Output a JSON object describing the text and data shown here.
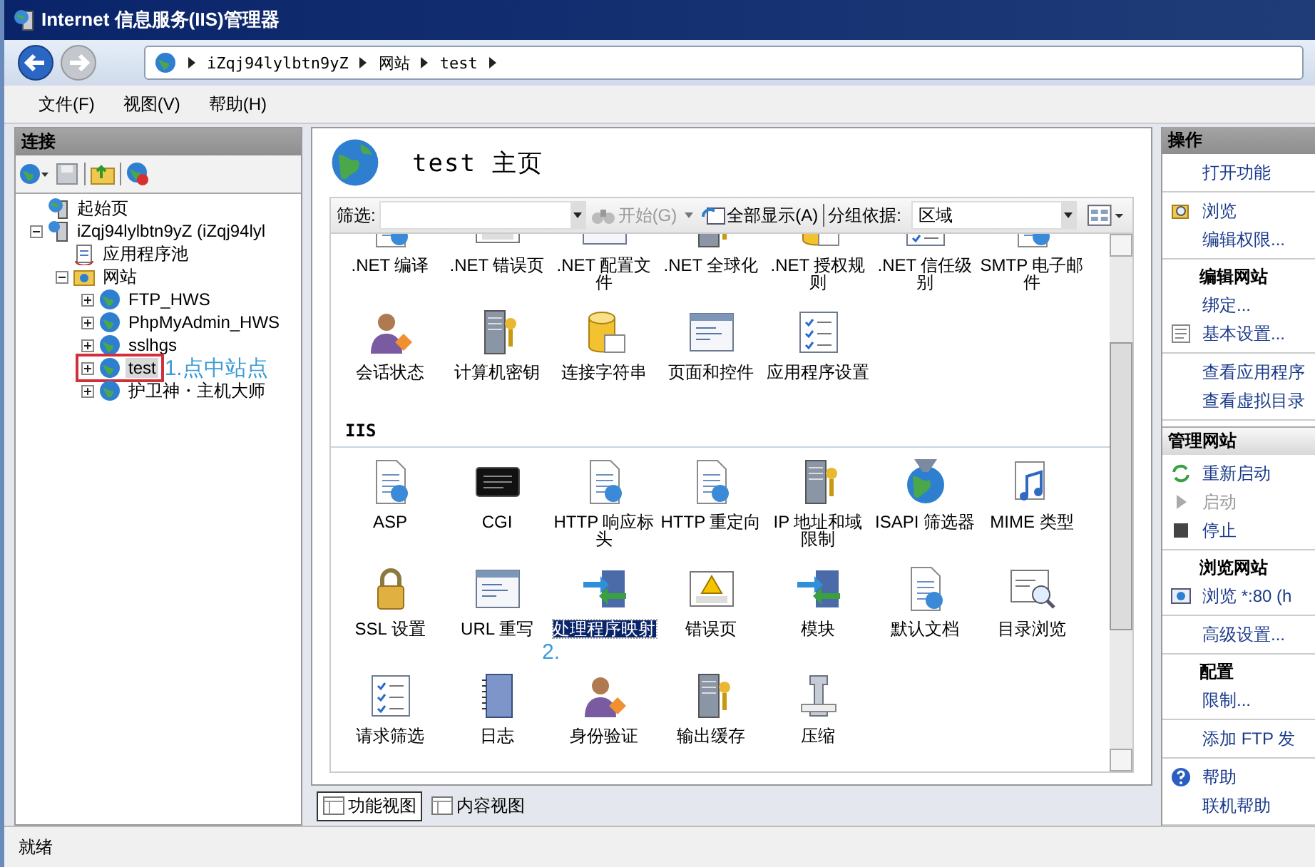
{
  "window": {
    "title": "Internet 信息服务(IIS)管理器"
  },
  "address": {
    "crumbs": [
      "iZqj94lylbtn9yZ",
      "网站",
      "test"
    ]
  },
  "menu": [
    "文件(F)",
    "视图(V)",
    "帮助(H)"
  ],
  "connections": {
    "title": "连接",
    "tree": [
      {
        "label": "起始页",
        "kind": "start",
        "selected": false,
        "marked": false
      },
      {
        "label": "iZqj94lylbtn9yZ (iZqj94lyl",
        "kind": "server",
        "expanded": true,
        "selected": false,
        "marked": false,
        "children": [
          {
            "label": "应用程序池",
            "kind": "pool",
            "selected": false,
            "marked": false
          },
          {
            "label": "网站",
            "kind": "folder",
            "expanded": true,
            "selected": false,
            "marked": false,
            "children": [
              {
                "label": "FTP_HWS",
                "kind": "site",
                "expanded": false,
                "selected": false,
                "marked": false
              },
              {
                "label": "PhpMyAdmin_HWS",
                "kind": "site",
                "expanded": false,
                "selected": false,
                "marked": false
              },
              {
                "label": "sslhgs",
                "kind": "site",
                "expanded": false,
                "selected": false,
                "marked": false
              },
              {
                "label": "test",
                "kind": "site",
                "expanded": false,
                "selected": true,
                "marked": true,
                "note": "1.点中站点"
              },
              {
                "label": "护卫神・主机大师",
                "kind": "site",
                "expanded": false,
                "selected": false,
                "marked": false
              }
            ]
          }
        ]
      }
    ]
  },
  "home": {
    "title": "test 主页",
    "filter": {
      "label": "筛选:",
      "go": {
        "label": "开始(G)",
        "disabled": true
      },
      "show_all": "全部显示(A)",
      "group_label": "分组依据:",
      "group_value": "区域"
    },
    "groups": [
      {
        "items": [
          {
            "label": ".NET 编译",
            "kind": "doc",
            "selected": false
          },
          {
            "label": ".NET 错误页",
            "kind": "warning",
            "selected": false
          },
          {
            "label": ".NET 配置文件",
            "kind": "window",
            "selected": false
          },
          {
            "label": ".NET 全球化",
            "kind": "server",
            "selected": false
          },
          {
            "label": ".NET 授权规则",
            "kind": "db",
            "selected": false
          },
          {
            "label": ".NET 信任级别",
            "kind": "checklist",
            "selected": false
          },
          {
            "label": "SMTP 电子邮件",
            "kind": "doc",
            "selected": false
          },
          {
            "label": "会话状态",
            "kind": "person",
            "selected": false
          },
          {
            "label": "计算机密钥",
            "kind": "server",
            "selected": false
          },
          {
            "label": "连接字符串",
            "kind": "db",
            "selected": false
          },
          {
            "label": "页面和控件",
            "kind": "window",
            "selected": false
          },
          {
            "label": "应用程序设置",
            "kind": "checklist",
            "selected": false
          }
        ]
      },
      {
        "title": "IIS",
        "items": [
          {
            "label": "ASP",
            "kind": "doc",
            "selected": false
          },
          {
            "label": "CGI",
            "kind": "console",
            "selected": false
          },
          {
            "label": "HTTP 响应标头",
            "kind": "doc",
            "selected": false
          },
          {
            "label": "HTTP 重定向",
            "kind": "doc",
            "selected": false
          },
          {
            "label": "IP 地址和域限制",
            "kind": "server",
            "selected": false
          },
          {
            "label": "ISAPI 筛选器",
            "kind": "globe",
            "selected": false
          },
          {
            "label": "MIME 类型",
            "kind": "music",
            "selected": false
          },
          {
            "label": "SSL 设置",
            "kind": "lock",
            "selected": false
          },
          {
            "label": "URL 重写",
            "kind": "window",
            "selected": false
          },
          {
            "label": "处理程序映射",
            "kind": "arrows",
            "selected": true,
            "note": "2."
          },
          {
            "label": "错误页",
            "kind": "warning",
            "selected": false
          },
          {
            "label": "模块",
            "kind": "arrows",
            "selected": false
          },
          {
            "label": "默认文档",
            "kind": "doc",
            "selected": false
          },
          {
            "label": "目录浏览",
            "kind": "magnifier",
            "selected": false
          },
          {
            "label": "请求筛选",
            "kind": "checklist",
            "selected": false
          },
          {
            "label": "日志",
            "kind": "notebook",
            "selected": false
          },
          {
            "label": "身份验证",
            "kind": "person",
            "selected": false
          },
          {
            "label": "输出缓存",
            "kind": "server",
            "selected": false
          },
          {
            "label": "压缩",
            "kind": "clamp",
            "selected": false
          }
        ]
      }
    ]
  },
  "view_tabs": [
    {
      "label": "功能视图",
      "selected": true
    },
    {
      "label": "内容视图",
      "selected": false
    }
  ],
  "actions": [
    {
      "title": "操作",
      "groups": [
        {
          "items": [
            {
              "label": "打开功能",
              "kind": "plain",
              "disabled": false
            }
          ]
        },
        {
          "items": [
            {
              "label": "浏览",
              "kind": "browse",
              "disabled": false
            },
            {
              "label": "编辑权限...",
              "kind": "plain",
              "disabled": false
            }
          ]
        },
        {
          "heading": "编辑网站",
          "items": [
            {
              "label": "绑定...",
              "kind": "plain",
              "disabled": false
            },
            {
              "label": "基本设置...",
              "kind": "settings",
              "disabled": false
            }
          ]
        },
        {
          "items": [
            {
              "label": "查看应用程序",
              "kind": "plain",
              "disabled": false
            },
            {
              "label": "查看虚拟目录",
              "kind": "plain",
              "disabled": false
            }
          ]
        }
      ]
    },
    {
      "title": "管理网站",
      "groups": [
        {
          "items": [
            {
              "label": "重新启动",
              "kind": "refresh",
              "disabled": false
            },
            {
              "label": "启动",
              "kind": "play",
              "disabled": true
            },
            {
              "label": "停止",
              "kind": "stop",
              "disabled": false
            }
          ]
        },
        {
          "heading": "浏览网站",
          "items": [
            {
              "label": "浏览 *:80 (h",
              "kind": "site",
              "disabled": false
            }
          ]
        },
        {
          "items": [
            {
              "label": "高级设置...",
              "kind": "plain",
              "disabled": false
            }
          ]
        },
        {
          "heading": "配置",
          "items": [
            {
              "label": "限制...",
              "kind": "plain",
              "disabled": false
            }
          ]
        },
        {
          "items": [
            {
              "label": "添加 FTP 发",
              "kind": "plain",
              "disabled": false
            }
          ]
        },
        {
          "items": [
            {
              "label": "帮助",
              "kind": "help",
              "disabled": false
            },
            {
              "label": "联机帮助",
              "kind": "plain",
              "disabled": false
            }
          ]
        }
      ]
    }
  ],
  "status_bar": "就绪"
}
